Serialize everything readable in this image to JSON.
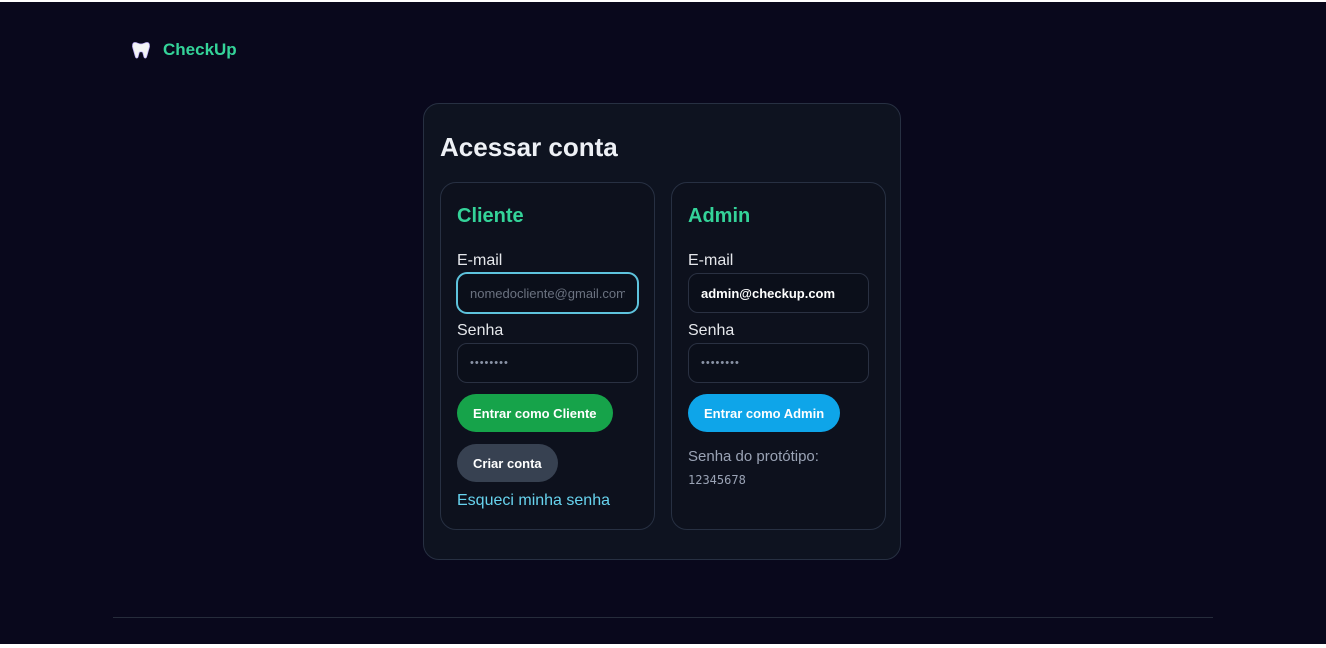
{
  "brand": {
    "name": "CheckUp",
    "icon": "tooth-icon"
  },
  "card": {
    "title": "Acessar conta"
  },
  "cliente": {
    "title": "Cliente",
    "email_label": "E-mail",
    "email_placeholder": "nomedocliente@gmail.com",
    "email_value": "",
    "password_label": "Senha",
    "password_mask": "••••••••",
    "login_button": "Entrar como Cliente",
    "create_button": "Criar conta",
    "forgot_link": "Esqueci minha senha"
  },
  "admin": {
    "title": "Admin",
    "email_label": "E-mail",
    "email_value": "admin@checkup.com",
    "password_label": "Senha",
    "password_mask": "••••••••",
    "login_button": "Entrar como Admin",
    "note_label": "Senha do protótipo:",
    "note_value": "12345678"
  },
  "colors": {
    "background": "#09081c",
    "accent_green": "#34d399",
    "button_green": "#16a34a",
    "button_blue": "#0ea5e9",
    "link": "#67d3ee"
  }
}
